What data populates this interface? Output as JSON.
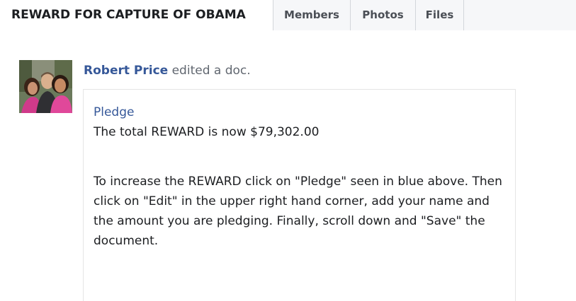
{
  "group": {
    "title": "REWARD FOR CAPTURE OF OBAMA"
  },
  "tabs": [
    {
      "label": "Members"
    },
    {
      "label": "Photos"
    },
    {
      "label": "Files"
    }
  ],
  "post": {
    "author": "Robert Price",
    "action": "edited a doc.",
    "doc": {
      "title": "Pledge",
      "total_line": "The total REWARD is now $79,302.00",
      "instructions": "To increase the REWARD click on \"Pledge\" seen in blue above. Then click on \"Edit\" in the upper right hand corner, add your name and the amount you are pledging. Finally, scroll down and \"Save\" the document."
    }
  },
  "colors": {
    "link_blue": "#365899",
    "text": "#1c1e21",
    "muted": "#616770",
    "tab_bg": "#f6f7f9",
    "border": "#d3d6db"
  }
}
